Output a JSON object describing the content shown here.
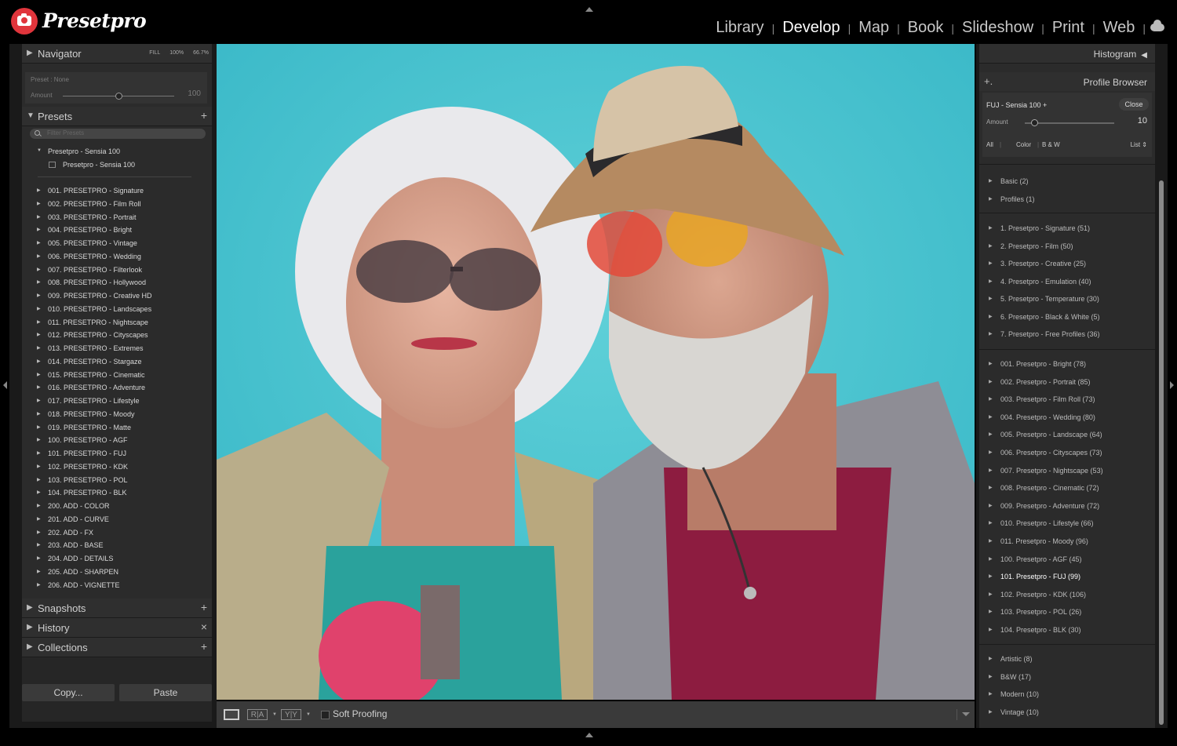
{
  "app": {
    "name": "Presetpro"
  },
  "modules": [
    {
      "label": "Library",
      "active": false
    },
    {
      "label": "Develop",
      "active": true
    },
    {
      "label": "Map",
      "active": false
    },
    {
      "label": "Book",
      "active": false
    },
    {
      "label": "Slideshow",
      "active": false
    },
    {
      "label": "Print",
      "active": false
    },
    {
      "label": "Web",
      "active": false
    }
  ],
  "left": {
    "navigator": {
      "title": "Navigator",
      "zoom_fill": "FILL",
      "zoom_100": "100%",
      "zoom_667": "66.7%"
    },
    "preset_box": {
      "preset": "Preset : None",
      "amount_label": "Amount",
      "amount_value": "100",
      "amount_level": 1.0
    },
    "presets": {
      "title": "Presets",
      "filter_placeholder": "Filter Presets",
      "open_group": "Presetpro - Sensia 100",
      "open_item": "Presetpro - Sensia 100",
      "groups": [
        "001. PRESETPRO - Signature",
        "002. PRESETPRO - Film Roll",
        "003. PRESETPRO - Portrait",
        "004. PRESETPRO - Bright",
        "005. PRESETPRO - Vintage",
        "006. PRESETPRO - Wedding",
        "007. PRESETPRO - Filterlook",
        "008. PRESETPRO - Hollywood",
        "009. PRESETPRO - Creative HD",
        "010. PRESETPRO - Landscapes",
        "011. PRESETPRO - Nightscape",
        "012. PRESETPRO - Cityscapes",
        "013. PRESETPRO - Extremes",
        "014. PRESETPRO - Stargaze",
        "015. PRESETPRO - Cinematic",
        "016. PRESETPRO - Adventure",
        "017. PRESETPRO - Lifestyle",
        "018. PRESETPRO - Moody",
        "019. PRESETPRO - Matte",
        "100. PRESETPRO - AGF",
        "101. PRESETPRO - FUJ",
        "102. PRESETPRO - KDK",
        "103. PRESETPRO - POL",
        "104. PRESETPRO - BLK",
        "200. ADD - COLOR",
        "201. ADD - CURVE",
        "202. ADD - FX",
        "203. ADD - BASE",
        "204. ADD - DETAILS",
        "205. ADD - SHARPEN",
        "206. ADD - VIGNETTE"
      ]
    },
    "snapshots": "Snapshots",
    "history": "History",
    "collections": "Collections",
    "copy_label": "Copy...",
    "paste_label": "Paste"
  },
  "toolbar": {
    "soft_proofing": "Soft Proofing",
    "ry1": "R|A",
    "ry2": "Y|Y"
  },
  "right": {
    "histogram": "Histogram",
    "profile_browser": "Profile Browser",
    "profile": {
      "name": "FUJ - Sensia 100 +",
      "close": "Close",
      "amount_label": "Amount",
      "amount_value": "10",
      "amount_level": 0.1
    },
    "filters": {
      "all": "All",
      "color": "Color",
      "bw": "B & W",
      "view": "List"
    },
    "group1": [
      "Basic (2)",
      "Profiles (1)"
    ],
    "group2": [
      "1. Presetpro - Signature (51)",
      "2. Presetpro - Film (50)",
      "3. Presetpro - Creative (25)",
      "4. Presetpro - Emulation (40)",
      "5. Presetpro - Temperature (30)",
      "6. Presetpro - Black & White (5)",
      "7. Presetpro - Free Profiles (36)"
    ],
    "group3": [
      "001. Presetpro - Bright (78)",
      "002. Presetpro - Portrait (85)",
      "003. Presetpro - Film Roll (73)",
      "004. Presetpro - Wedding (80)",
      "005. Presetpro - Landscape (64)",
      "006. Presetpro - Cityscapes (73)",
      "007. Presetpro - Nightscape (53)",
      "008. Presetpro - Cinematic (72)",
      "009. Presetpro - Adventure (72)",
      "010. Presetpro - Lifestyle (66)",
      "011. Presetpro - Moody (96)",
      "100. Presetpro - AGF (45)",
      "101. Presetpro - FUJ (99)",
      "102. Presetpro - KDK (106)",
      "103. Presetpro - POL (26)",
      "104. Presetpro - BLK (30)"
    ],
    "group3_selected": "101. Presetpro - FUJ (99)",
    "group4": [
      "Artistic (8)",
      "B&W (17)",
      "Modern (10)",
      "Vintage (10)"
    ]
  }
}
